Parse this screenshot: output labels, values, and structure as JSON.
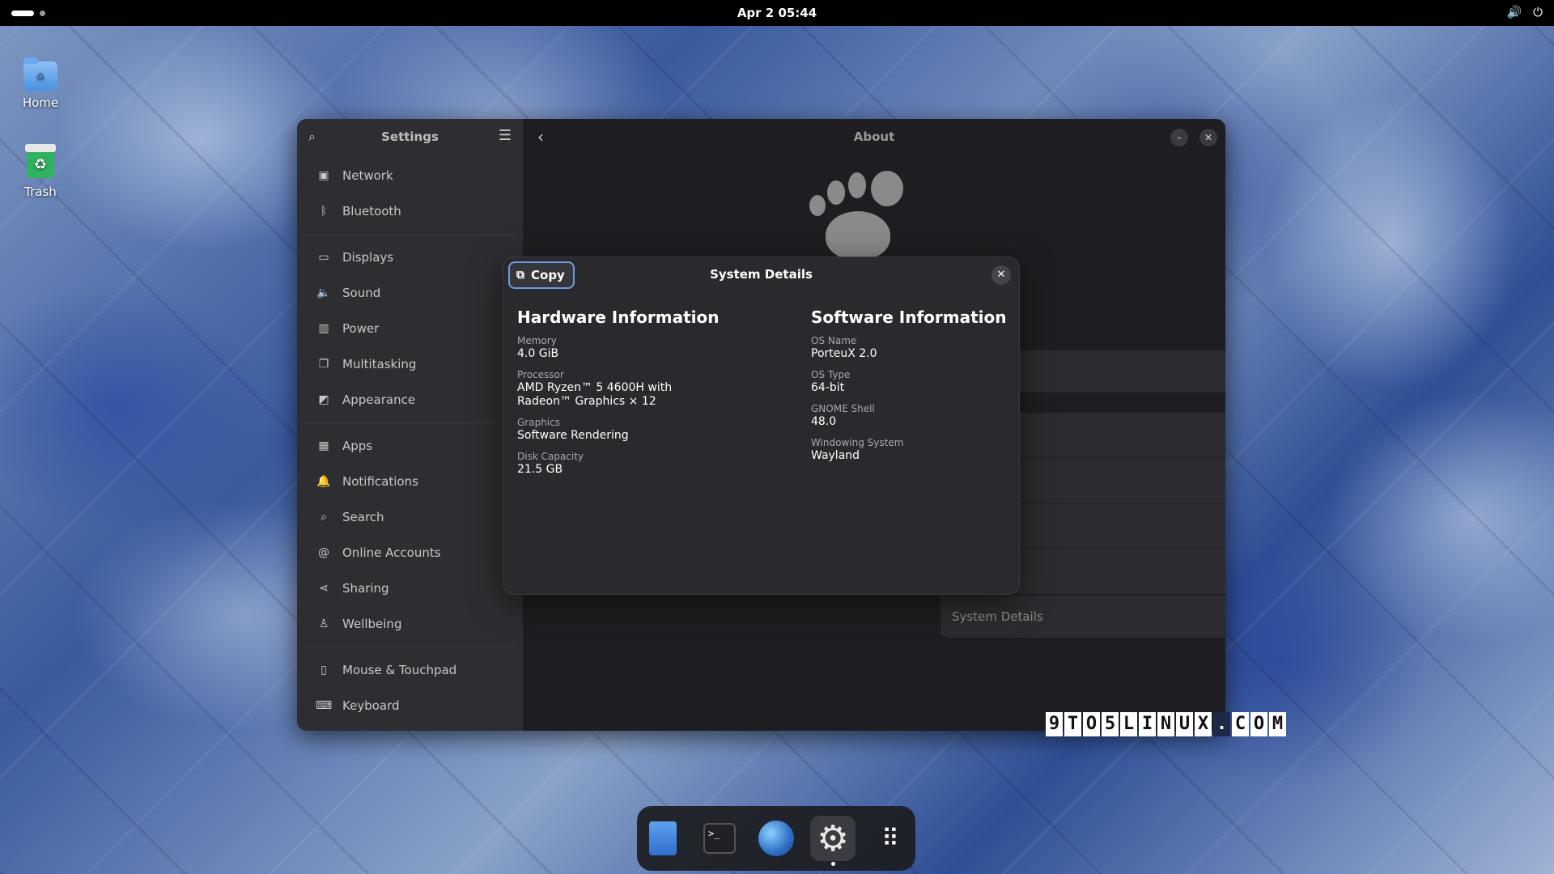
{
  "topbar": {
    "clock": "Apr 2  05:44"
  },
  "desktop": {
    "home_label": "Home",
    "trash_label": "Trash"
  },
  "settings": {
    "sidebar_title": "Settings",
    "content_title": "About",
    "sidebar_items": [
      {
        "label": "Network",
        "icon": "network-icon"
      },
      {
        "label": "Bluetooth",
        "icon": "bluetooth-icon"
      },
      {
        "label": "Displays",
        "icon": "display-icon"
      },
      {
        "label": "Sound",
        "icon": "sound-icon"
      },
      {
        "label": "Power",
        "icon": "power-icon"
      },
      {
        "label": "Multitasking",
        "icon": "multitasking-icon"
      },
      {
        "label": "Appearance",
        "icon": "appearance-icon"
      },
      {
        "label": "Apps",
        "icon": "apps-icon"
      },
      {
        "label": "Notifications",
        "icon": "bell-icon"
      },
      {
        "label": "Search",
        "icon": "search-icon"
      },
      {
        "label": "Online Accounts",
        "icon": "at-icon"
      },
      {
        "label": "Sharing",
        "icon": "share-icon"
      },
      {
        "label": "Wellbeing",
        "icon": "wellbeing-icon"
      },
      {
        "label": "Mouse & Touchpad",
        "icon": "mouse-icon"
      },
      {
        "label": "Keyboard",
        "icon": "keyboard-icon"
      }
    ],
    "system_details_row": "System Details"
  },
  "dialog": {
    "title": "System Details",
    "copy_label": "Copy",
    "hardware": {
      "heading": "Hardware Information",
      "memory_label": "Memory",
      "memory_value": "4.0 GiB",
      "processor_label": "Processor",
      "processor_value_line1": "AMD Ryzen™ 5 4600H with",
      "processor_value_line2": "Radeon™ Graphics × 12",
      "graphics_label": "Graphics",
      "graphics_value": "Software Rendering",
      "disk_label": "Disk Capacity",
      "disk_value": "21.5 GB"
    },
    "software": {
      "heading": "Software Information",
      "os_name_label": "OS Name",
      "os_name_value": "PorteuX 2.0",
      "os_type_label": "OS Type",
      "os_type_value": "64-bit",
      "gnome_label": "GNOME Shell",
      "gnome_value": "48.0",
      "windowing_label": "Windowing System",
      "windowing_value": "Wayland"
    }
  },
  "watermark": {
    "chars": [
      "9",
      "T",
      "O",
      "5",
      "L",
      "I",
      "N",
      "U",
      "X",
      ".",
      "C",
      "O",
      "M"
    ]
  },
  "dock": {
    "items": [
      "text-editor-icon",
      "terminal-icon",
      "browser-icon",
      "settings-icon",
      "app-grid-icon"
    ]
  }
}
